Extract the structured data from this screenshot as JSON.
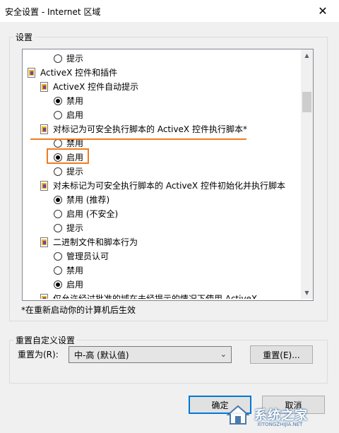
{
  "window": {
    "title": "安全设置 - Internet 区域"
  },
  "settings_group": {
    "label": "设置"
  },
  "tree": {
    "item_prompt_top": "提示",
    "activex_category": "ActiveX 控件和插件",
    "auto_prompt_item": "ActiveX 控件自动提示",
    "auto_prompt_disable": "禁用",
    "auto_prompt_enable": "启用",
    "safe_script_item": "对标记为可安全执行脚本的 ActiveX 控件执行脚本*",
    "safe_script_disable": "禁用",
    "safe_script_enable": "启用",
    "safe_script_prompt": "提示",
    "unsafe_init_item": "对未标记为可安全执行脚本的 ActiveX 控件初始化并执行脚本",
    "unsafe_init_disable": "禁用 (推荐)",
    "unsafe_init_enable": "启用 (不安全)",
    "unsafe_init_prompt": "提示",
    "binary_behavior_item": "二进制文件和脚本行为",
    "binary_admin": "管理员认可",
    "binary_disable": "禁用",
    "binary_enable": "启用",
    "cut_off_item": "仅允许经过批准的域在未经提示的情况下使用 ActiveX"
  },
  "note": "*在重新启动你的计算机后生效",
  "reset_group": {
    "label": "重置自定义设置",
    "reset_to_label": "重置为(R):",
    "selected_level": "中-高 (默认值)",
    "reset_button": "重置(E)..."
  },
  "buttons": {
    "ok": "确定",
    "cancel": "取消"
  },
  "watermark": {
    "text": "系统之家",
    "sub": "XITONGZHIJIA.NET"
  },
  "colors": {
    "highlight": "#f07d20",
    "accent": "#0078d7"
  }
}
